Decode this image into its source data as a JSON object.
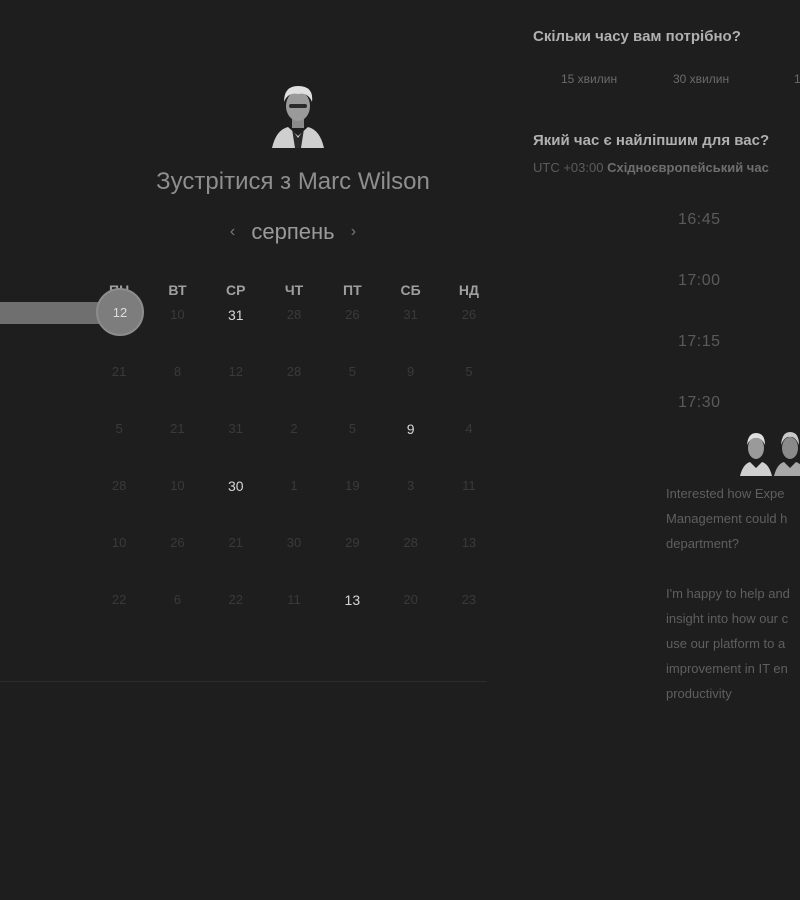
{
  "host": {
    "title_prefix": "Зустрітися з",
    "name": "Marc Wilson",
    "avatar_icon": "person-avatar-icon"
  },
  "calendar": {
    "month": "серпень",
    "prev_icon": "chevron-left-icon",
    "next_icon": "chevron-right-icon",
    "weekdays": [
      "ПН",
      "ВТ",
      "СР",
      "ЧТ",
      "ПТ",
      "СБ",
      "НД"
    ],
    "rows": [
      [
        "12",
        "10",
        "31",
        "28",
        "26",
        "31",
        "26"
      ],
      [
        "21",
        "8",
        "12",
        "28",
        "5",
        "9",
        "5"
      ],
      [
        "5",
        "21",
        "31",
        "2",
        "5",
        "9",
        "4"
      ],
      [
        "28",
        "10",
        "30",
        "1",
        "19",
        "3",
        "11"
      ],
      [
        "10",
        "26",
        "21",
        "30",
        "29",
        "28",
        "13"
      ],
      [
        "22",
        "6",
        "22",
        "11",
        "13",
        "20",
        "23"
      ]
    ],
    "available": [
      [
        0,
        2
      ],
      [
        2,
        5
      ],
      [
        3,
        2
      ],
      [
        5,
        4
      ]
    ],
    "selected_day": "12"
  },
  "duration": {
    "heading": "Скільки часу вам потрібно?",
    "options": [
      "15 хвилин",
      "30 хвилин",
      "1"
    ]
  },
  "time": {
    "heading": "Який час є найліпшим для вас?",
    "tz_offset": "UTC +03:00",
    "tz_name": "Східноєвропейський час",
    "slots": [
      "16:45",
      "17:00",
      "17:15",
      "17:30"
    ]
  },
  "message": {
    "paragraph1": [
      "Interested how Expe",
      "Management could h",
      "department?"
    ],
    "paragraph2": [
      "I'm happy to help and",
      "insight into how our c",
      "use our platform to a",
      "improvement in IT en",
      "productivity"
    ]
  },
  "colors": {
    "background": "#1e1e1e",
    "available_day": "#d6d6d6",
    "unavailable_day": "#3a3a3a",
    "slider": "#7d7d7d"
  }
}
